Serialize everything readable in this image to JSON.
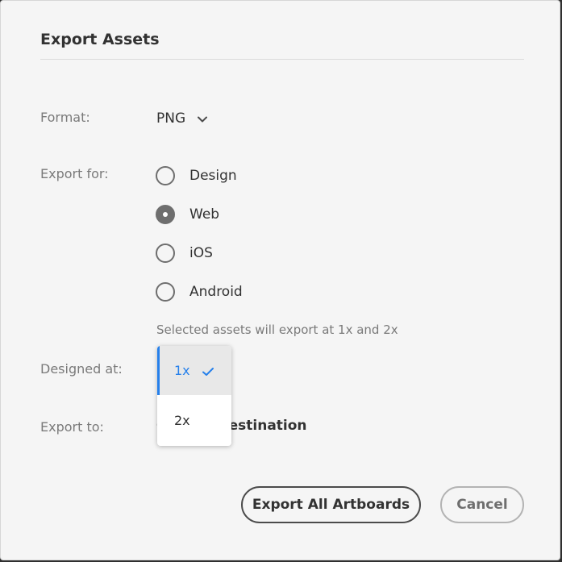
{
  "dialog": {
    "title": "Export Assets"
  },
  "format": {
    "label": "Format:",
    "value": "PNG",
    "icon": "chevron-down-icon"
  },
  "export_for": {
    "label": "Export for:",
    "options": [
      {
        "label": "Design",
        "checked": false
      },
      {
        "label": "Web",
        "checked": true
      },
      {
        "label": "iOS",
        "checked": false
      },
      {
        "label": "Android",
        "checked": false
      }
    ],
    "hint": "Selected assets will export at 1x and 2x"
  },
  "designed_at": {
    "label": "Designed at:",
    "dropdown_options": [
      {
        "label": "1x",
        "selected": true
      },
      {
        "label": "2x",
        "selected": false
      }
    ]
  },
  "export_to": {
    "label": "Export to:",
    "destination_text": "Choose Destination"
  },
  "buttons": {
    "primary": "Export All Artboards",
    "secondary": "Cancel"
  },
  "colors": {
    "accent": "#2680eb",
    "dialog_bg": "#f5f5f5",
    "text": "#323232",
    "muted": "#7a7a7a"
  }
}
